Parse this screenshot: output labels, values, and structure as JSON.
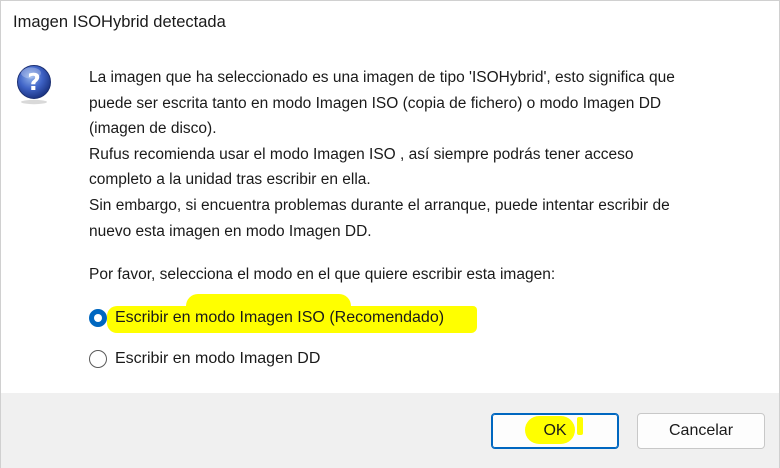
{
  "window": {
    "title": "Imagen ISOHybrid detectada"
  },
  "message": {
    "lines": [
      "La imagen que ha seleccionado es una imagen de tipo 'ISOHybrid', esto significa que",
      "puede ser escrita tanto en modo Imagen ISO (copia de fichero) o modo Imagen DD",
      "(imagen de disco).",
      "Rufus recomienda usar el modo Imagen ISO , así siempre podrás tener acceso",
      "completo a la unidad tras escribir en ella.",
      "Sin embargo, si encuentra problemas durante el arranque, puede intentar escribir de",
      "nuevo esta imagen en modo Imagen DD."
    ],
    "prompt": "Por favor, selecciona el modo en el que quiere escribir esta imagen:"
  },
  "options": [
    {
      "label": "Escribir en modo Imagen ISO (Recomendado)",
      "checked": true
    },
    {
      "label": "Escribir en modo Imagen DD",
      "checked": false
    }
  ],
  "buttons": {
    "ok": "OK",
    "cancel": "Cancelar"
  },
  "icon": "question-icon",
  "colors": {
    "accent": "#0067c0",
    "highlight": "#ffff00",
    "footer": "#f0f0f0"
  }
}
